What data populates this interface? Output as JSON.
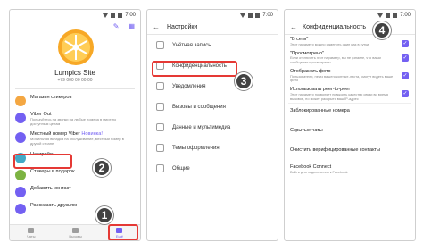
{
  "statusbar": {
    "time": "7:00"
  },
  "phone1": {
    "profile_name": "Lumpics Site",
    "profile_phone": "+79 000 00 00 00",
    "menu": [
      {
        "title": "Магазин стикеров",
        "sub": "",
        "color": "#f4a742"
      },
      {
        "title": "Viber Out",
        "sub": "Пользуйтесь на звонки на любые номера в мире по доступным ценам",
        "color": "#7360f2"
      },
      {
        "title": "Местный номер Viber",
        "title_extra": "Новинка!",
        "sub": "Мобильная вкладка на обслуживание, местный номер в другой стране",
        "color": "#7360f2"
      },
      {
        "title": "Настройки",
        "sub": "",
        "color": "#43a9c7"
      },
      {
        "title": "Стикеры в подарок",
        "sub": "",
        "color": "#7cb342"
      },
      {
        "title": "Добавить контакт",
        "sub": "",
        "color": "#7360f2"
      },
      {
        "title": "Рассказать друзьям",
        "sub": "",
        "color": "#7360f2"
      }
    ],
    "nav": [
      {
        "label": "Чаты"
      },
      {
        "label": "Вызовы"
      },
      {
        "label": "Ещё"
      }
    ]
  },
  "phone2": {
    "title": "Настройки",
    "menu": [
      {
        "label": "Учётная запись"
      },
      {
        "label": "Конфиденциальность"
      },
      {
        "label": "Уведомления"
      },
      {
        "label": "Вызовы и сообщения"
      },
      {
        "label": "Данные и мультимедиа"
      },
      {
        "label": "Темы оформления"
      },
      {
        "label": "Общие"
      }
    ]
  },
  "phone3": {
    "title": "Конфиденциальность",
    "items": [
      {
        "title": "\"В сети\"",
        "sub": "Этот параметр можно изменить один раз в сутки",
        "checked": true
      },
      {
        "title": "\"Просмотрено\"",
        "sub": "Если отключить этот параметр, вы не узнаете, что ваши сообщения просмотрены",
        "checked": true
      },
      {
        "title": "Отображать фото",
        "sub": "Пользователи, не из вашего контакт-листа, смогут видеть ваше фото",
        "checked": true
      },
      {
        "title": "Использовать peer-to-peer",
        "sub": "Этот параметр позволяет повысить качество связи во время вызовов, но может раскрыть ваш IP-адрес",
        "checked": true
      }
    ],
    "plain_items": [
      {
        "title": "Заблокированные номера"
      },
      {
        "title": "Скрытые чаты"
      },
      {
        "title": "Очистить верифицированные контакты"
      },
      {
        "title": "Facebook Connect",
        "sub": "Войти для подключения к Facebook"
      }
    ]
  },
  "steps": [
    "1",
    "2",
    "3",
    "4"
  ],
  "colors": {
    "accent": "#7360f2",
    "highlight": "#e53935",
    "step_badge": "#424242"
  }
}
